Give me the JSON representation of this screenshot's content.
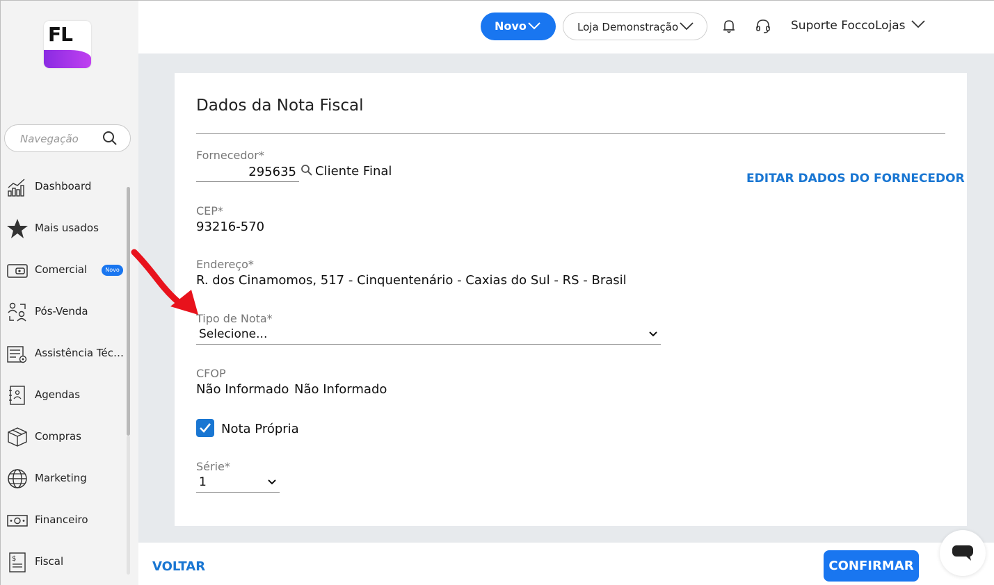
{
  "sidebar": {
    "logo_text": "FL",
    "search_placeholder": "Navegação",
    "items": [
      {
        "label": "Dashboard",
        "icon": "chart-icon"
      },
      {
        "label": "Mais usados",
        "icon": "star-icon"
      },
      {
        "label": "Comercial",
        "icon": "wallet-icon",
        "badge": "Novo"
      },
      {
        "label": "Pós-Venda",
        "icon": "people-exchange-icon"
      },
      {
        "label": "Assistência Técnica",
        "icon": "tools-list-icon"
      },
      {
        "label": "Agendas",
        "icon": "agenda-icon"
      },
      {
        "label": "Compras",
        "icon": "box-icon"
      },
      {
        "label": "Marketing",
        "icon": "globe-icon"
      },
      {
        "label": "Financeiro",
        "icon": "money-icon"
      },
      {
        "label": "Fiscal",
        "icon": "dollar-document-icon"
      }
    ]
  },
  "topbar": {
    "new_button": "Novo",
    "store": "Loja Demonstração",
    "user": "Suporte FoccoLojas"
  },
  "card": {
    "title": "Dados da Nota Fiscal",
    "supplier_label": "Fornecedor*",
    "supplier_code": "295635",
    "supplier_name": "Cliente Final",
    "edit_supplier_link": "EDITAR DADOS DO FORNECEDOR",
    "cep_label": "CEP*",
    "cep_value": "93216-570",
    "address_label": "Endereço*",
    "address_value": "R. dos Cinamomos, 517 - Cinquentenário - Caxias do Sul - RS - Brasil",
    "note_type_label": "Tipo de Nota*",
    "note_type_value": "Selecione...",
    "cfop_label": "CFOP",
    "cfop_value_1": "Não Informado",
    "cfop_value_2": "Não Informado",
    "own_note_label": "Nota Própria",
    "own_note_checked": true,
    "series_label": "Série*",
    "series_value": "1"
  },
  "footer": {
    "back_button": "VOLTAR",
    "confirm_button": "CONFIRMAR"
  },
  "colors": {
    "accent": "#1976f0",
    "link": "#1976d2",
    "background": "#e7eaed",
    "annotation_arrow": "#e8121c"
  }
}
